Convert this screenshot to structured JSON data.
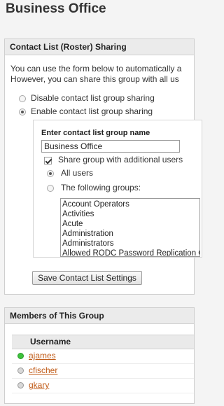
{
  "page": {
    "title": "Business Office"
  },
  "sharing": {
    "header": "Contact List (Roster) Sharing",
    "description_lines": [
      "You can use the form below to automatically a",
      "However, you can share this group with all us"
    ],
    "options": [
      {
        "label": "Disable contact list group sharing",
        "selected": false
      },
      {
        "label": "Enable contact list group sharing",
        "selected": true
      }
    ],
    "group_name_heading": "Enter contact list group name",
    "group_name_value": "Business Office",
    "share_additional_label": "Share group with additional users",
    "share_additional_checked": true,
    "share_targets": [
      {
        "label": "All users",
        "selected": true
      },
      {
        "label": "The following groups:",
        "selected": false
      }
    ],
    "groups": [
      "Account Operators",
      "Activities",
      "Acute",
      "Administration",
      "Administrators",
      "Allowed RODC Password Replication Group"
    ],
    "save_label": "Save Contact List Settings"
  },
  "members": {
    "header": "Members of This Group",
    "column_username": "Username",
    "rows": [
      {
        "username": "ajames",
        "status_color": "#3cc23c",
        "status_ring": "#2a9a2a"
      },
      {
        "username": "cfischer",
        "status_color": "#d8d8d8",
        "status_ring": "#9a9a9a"
      },
      {
        "username": "gkary",
        "status_color": "#d8d8d8",
        "status_ring": "#9a9a9a"
      }
    ]
  }
}
